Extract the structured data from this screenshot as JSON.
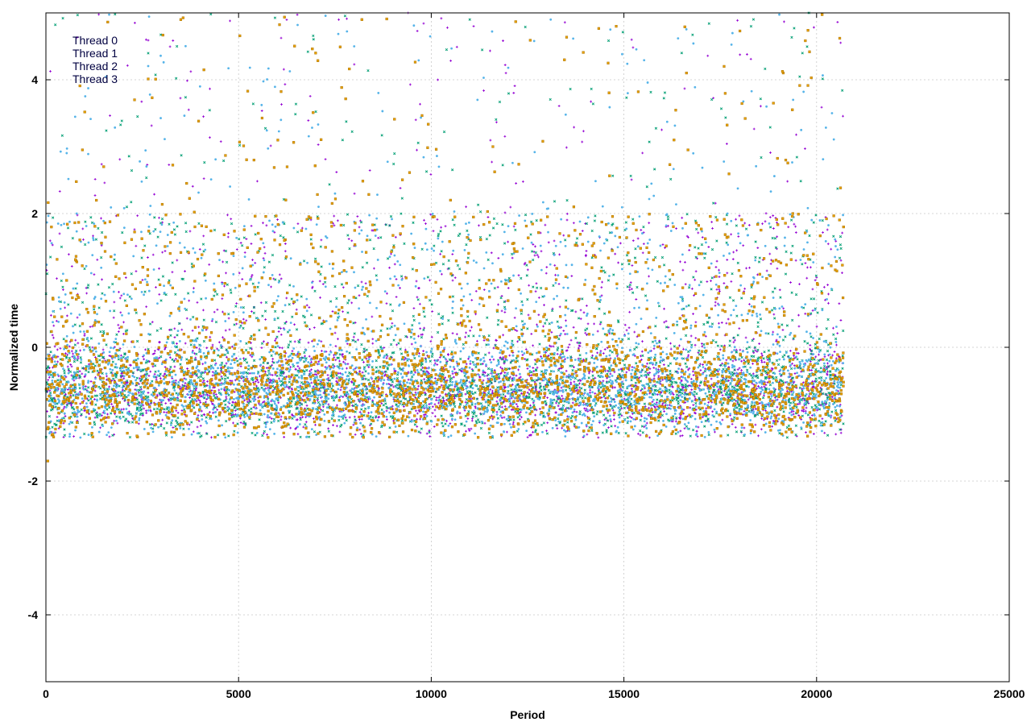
{
  "chart_data": {
    "type": "scatter",
    "title": "",
    "xlabel": "Period",
    "ylabel": "Normalized time",
    "xlim": [
      0,
      25000
    ],
    "ylim": [
      -5,
      5
    ],
    "xticks": [
      0,
      5000,
      10000,
      15000,
      20000,
      25000
    ],
    "yticks": [
      -4,
      -2,
      0,
      2,
      4
    ],
    "xtick_labels": [
      "0",
      "5000",
      "10000",
      "15000",
      "20000",
      "25000"
    ],
    "ytick_labels": [
      "-4",
      "-2",
      "0",
      "2",
      "4"
    ],
    "grid": true,
    "legend_position": "top-left",
    "series": [
      {
        "name": "Thread 0",
        "color": "#9400d3",
        "marker": "plus",
        "x_range": [
          0,
          20700
        ],
        "points": [
          [
            200,
            -0.9
          ],
          [
            900,
            -0.7
          ],
          [
            1600,
            -1.0
          ],
          [
            2600,
            4.6
          ],
          [
            3300,
            -1.2
          ],
          [
            4100,
            -0.5
          ],
          [
            5200,
            0.4
          ],
          [
            6300,
            -0.6
          ],
          [
            7600,
            4.9
          ],
          [
            8500,
            -0.4
          ],
          [
            9400,
            5.0
          ],
          [
            10400,
            -1.1
          ],
          [
            11100,
            4.8
          ],
          [
            11800,
            -0.3
          ],
          [
            12600,
            0.2
          ],
          [
            13400,
            -0.8
          ],
          [
            14600,
            -1.2
          ],
          [
            15200,
            4.6
          ],
          [
            16000,
            -0.2
          ],
          [
            17200,
            1.5
          ],
          [
            18400,
            -0.7
          ],
          [
            19400,
            -1.0
          ],
          [
            20200,
            0.9
          ],
          [
            20500,
            -1.3
          ]
        ]
      },
      {
        "name": "Thread 1",
        "color": "#009e73",
        "marker": "cross",
        "x_range": [
          0,
          20700
        ],
        "points": [
          [
            300,
            -1.1
          ],
          [
            1100,
            -0.6
          ],
          [
            2100,
            2.1
          ],
          [
            3400,
            4.5
          ],
          [
            4400,
            -0.9
          ],
          [
            5500,
            0.9
          ],
          [
            6700,
            -0.4
          ],
          [
            7700,
            3.1
          ],
          [
            8800,
            -0.8
          ],
          [
            9900,
            -0.5
          ],
          [
            11000,
            4.9
          ],
          [
            12100,
            -0.2
          ],
          [
            13200,
            -0.9
          ],
          [
            14300,
            -1.0
          ],
          [
            15600,
            2.4
          ],
          [
            16500,
            4.4
          ],
          [
            17500,
            -0.6
          ],
          [
            18300,
            4.8
          ],
          [
            19100,
            -0.3
          ],
          [
            19800,
            5.0
          ],
          [
            20600,
            -1.1
          ]
        ]
      },
      {
        "name": "Thread 2",
        "color": "#56b4e9",
        "marker": "star",
        "x_range": [
          0,
          20700
        ],
        "points": [
          [
            100,
            -0.8
          ],
          [
            800,
            2.0
          ],
          [
            1700,
            -1.2
          ],
          [
            2900,
            -0.2
          ],
          [
            4000,
            3.9
          ],
          [
            5000,
            -0.7
          ],
          [
            6100,
            3.4
          ],
          [
            7300,
            -0.9
          ],
          [
            8000,
            4.5
          ],
          [
            9100,
            -0.6
          ],
          [
            10200,
            2.7
          ],
          [
            11200,
            3.7
          ],
          [
            12300,
            -0.4
          ],
          [
            13100,
            4.9
          ],
          [
            14200,
            -0.8
          ],
          [
            15100,
            3.8
          ],
          [
            15900,
            -1.0
          ],
          [
            16800,
            2.9
          ],
          [
            17800,
            -0.5
          ],
          [
            18700,
            3.6
          ],
          [
            19600,
            -1.2
          ],
          [
            20400,
            3.5
          ]
        ]
      },
      {
        "name": "Thread 3",
        "color": "#e69f00",
        "marker": "box",
        "x_range": [
          0,
          20700
        ],
        "points": [
          [
            50,
            -1.7
          ],
          [
            600,
            -0.8
          ],
          [
            1500,
            2.7
          ],
          [
            2300,
            3.7
          ],
          [
            3500,
            4.9
          ],
          [
            4600,
            -0.3
          ],
          [
            5400,
            2.8
          ],
          [
            6500,
            -1.0
          ],
          [
            7000,
            4.4
          ],
          [
            8200,
            4.9
          ],
          [
            9300,
            -0.5
          ],
          [
            10500,
            2.2
          ],
          [
            10900,
            -0.9
          ],
          [
            11600,
            3.0
          ],
          [
            12500,
            -0.6
          ],
          [
            13700,
            2.1
          ],
          [
            14800,
            4.8
          ],
          [
            15500,
            -0.9
          ],
          [
            16300,
            3.1
          ],
          [
            17600,
            4.2
          ],
          [
            18400,
            -0.2
          ],
          [
            19200,
            2.8
          ],
          [
            20100,
            -0.7
          ],
          [
            20700,
            1.8
          ]
        ]
      }
    ]
  }
}
